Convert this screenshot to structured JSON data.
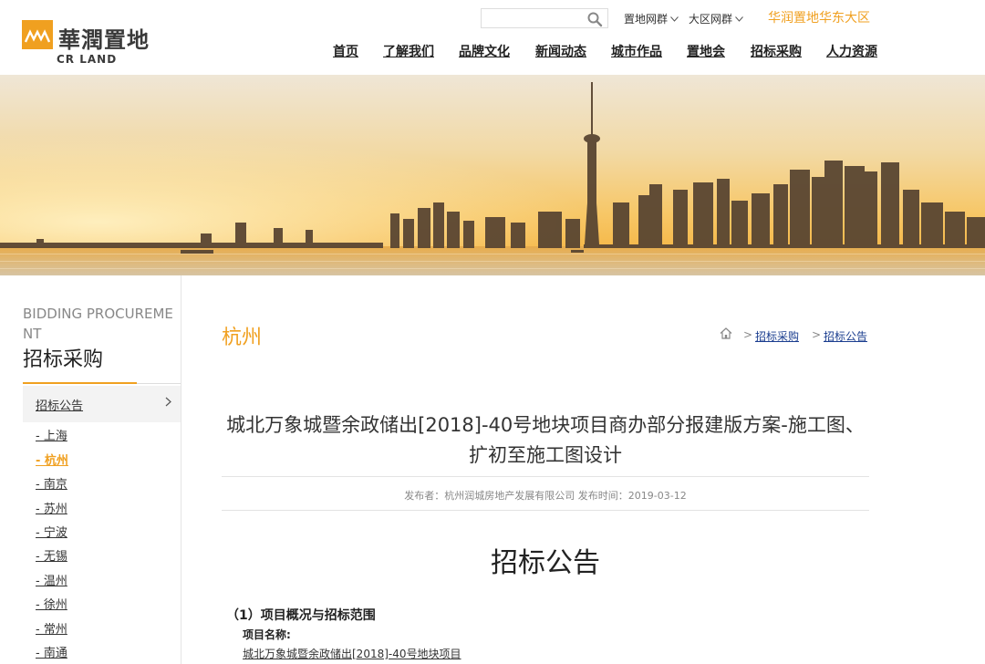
{
  "header": {
    "logo": {
      "cn": "華潤置地",
      "en": "CR LAND"
    },
    "search": {
      "placeholder": "",
      "value": ""
    },
    "top_links": [
      {
        "label": "置地网群"
      },
      {
        "label": "大区网群"
      }
    ],
    "region_label": "华润置地华东大区",
    "nav": [
      {
        "label": "首页"
      },
      {
        "label": "了解我们"
      },
      {
        "label": "品牌文化"
      },
      {
        "label": "新闻动态"
      },
      {
        "label": "城市作品"
      },
      {
        "label": "置地会"
      },
      {
        "label": "招标采购"
      },
      {
        "label": "人力资源"
      }
    ]
  },
  "sidebar": {
    "section_en": "BIDDING PROCUREMENT",
    "section_cn": "招标采购",
    "active_item": "招标公告",
    "cities": [
      {
        "label": "- 上海"
      },
      {
        "label": "- 杭州",
        "active": true
      },
      {
        "label": "- 南京"
      },
      {
        "label": "- 苏州"
      },
      {
        "label": "- 宁波"
      },
      {
        "label": "- 无锡"
      },
      {
        "label": "- 温州"
      },
      {
        "label": "- 徐州"
      },
      {
        "label": "- 常州"
      },
      {
        "label": "- 南通"
      }
    ]
  },
  "main": {
    "city": "杭州",
    "breadcrumb": [
      {
        "label": "招标采购"
      },
      {
        "label": "招标公告"
      }
    ],
    "title": "城北万象城暨余政储出[2018]-40号地块项目商办部分报建版方案-施工图、扩初至施工图设计",
    "meta": "发布者：杭州润城房地产发展有限公司    发布时间：2019-03-12",
    "doc_heading": "招标公告",
    "section_heading": "（1）项目概况与招标范围",
    "project_name_label": "项目名称:",
    "project_name_value": "城北万象城暨余政储出[2018]-40号地块项目"
  },
  "colors": {
    "accent": "#f0a020",
    "text": "#333333",
    "link_blue": "#1a3d8f"
  },
  "icons": [
    "search-icon",
    "chevron-down-icon",
    "chevron-right-icon",
    "home-icon",
    "logo-mark-icon"
  ]
}
